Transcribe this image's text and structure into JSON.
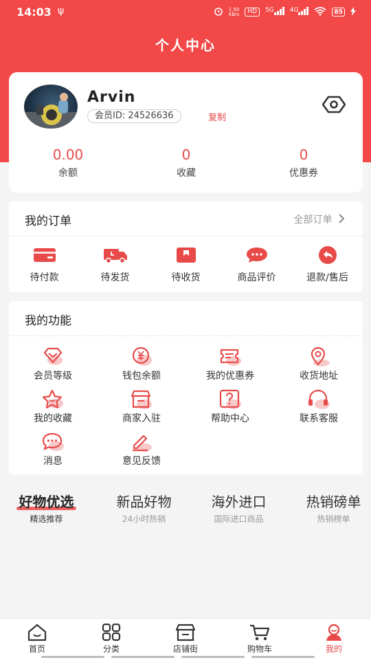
{
  "status_bar": {
    "time": "14:03",
    "usb": "ψ",
    "net_speed_top": "1.50",
    "net_speed_bottom": "KB/s",
    "hd": "HD",
    "sig1": "5G",
    "sig2": "4G",
    "battery": "85"
  },
  "header": {
    "title": "个人中心"
  },
  "profile": {
    "username": "Arvin",
    "member_id": "会员ID: 24526636",
    "copy_label": "复制",
    "stats": [
      {
        "value": "0.00",
        "label": "余额"
      },
      {
        "value": "0",
        "label": "收藏"
      },
      {
        "value": "0",
        "label": "优惠券"
      }
    ]
  },
  "orders": {
    "title": "我的订单",
    "more": "全部订单",
    "items": [
      {
        "label": "待付款",
        "icon": "wallet-card-icon"
      },
      {
        "label": "待发货",
        "icon": "truck-icon"
      },
      {
        "label": "待收货",
        "icon": "package-receive-icon"
      },
      {
        "label": "商品评价",
        "icon": "comment-bubble-icon"
      },
      {
        "label": "退款/售后",
        "icon": "return-arrow-icon"
      }
    ]
  },
  "functions": {
    "title": "我的功能",
    "items": [
      {
        "label": "会员等级",
        "icon": "diamond-icon"
      },
      {
        "label": "钱包余额",
        "icon": "yuan-coin-icon"
      },
      {
        "label": "我的优惠券",
        "icon": "coupon-icon"
      },
      {
        "label": "收货地址",
        "icon": "location-pin-icon"
      },
      {
        "label": "我的收藏",
        "icon": "star-icon"
      },
      {
        "label": "商家入驻",
        "icon": "storefront-icon"
      },
      {
        "label": "帮助中心",
        "icon": "question-icon"
      },
      {
        "label": "联系客服",
        "icon": "headset-icon"
      },
      {
        "label": "消息",
        "icon": "message-icon"
      },
      {
        "label": "意见反馈",
        "icon": "pencil-icon"
      }
    ]
  },
  "tabs": [
    {
      "title": "好物优选",
      "subtitle": "精选推荐",
      "active": true
    },
    {
      "title": "新品好物",
      "subtitle": "24小时热销"
    },
    {
      "title": "海外进口",
      "subtitle": "国际进口商品"
    },
    {
      "title": "热销磅单",
      "subtitle": "热销榜单"
    }
  ],
  "bottom_nav": [
    {
      "label": "首页",
      "icon": "home-icon"
    },
    {
      "label": "分类",
      "icon": "grid-icon"
    },
    {
      "label": "店铺街",
      "icon": "shop-icon"
    },
    {
      "label": "购物车",
      "icon": "cart-icon"
    },
    {
      "label": "我的",
      "icon": "user-icon",
      "active": true
    }
  ],
  "colors": {
    "accent": "#f24848",
    "accent_text": "#e84a4a",
    "muted": "#999999",
    "background": "#f4f4f4"
  }
}
